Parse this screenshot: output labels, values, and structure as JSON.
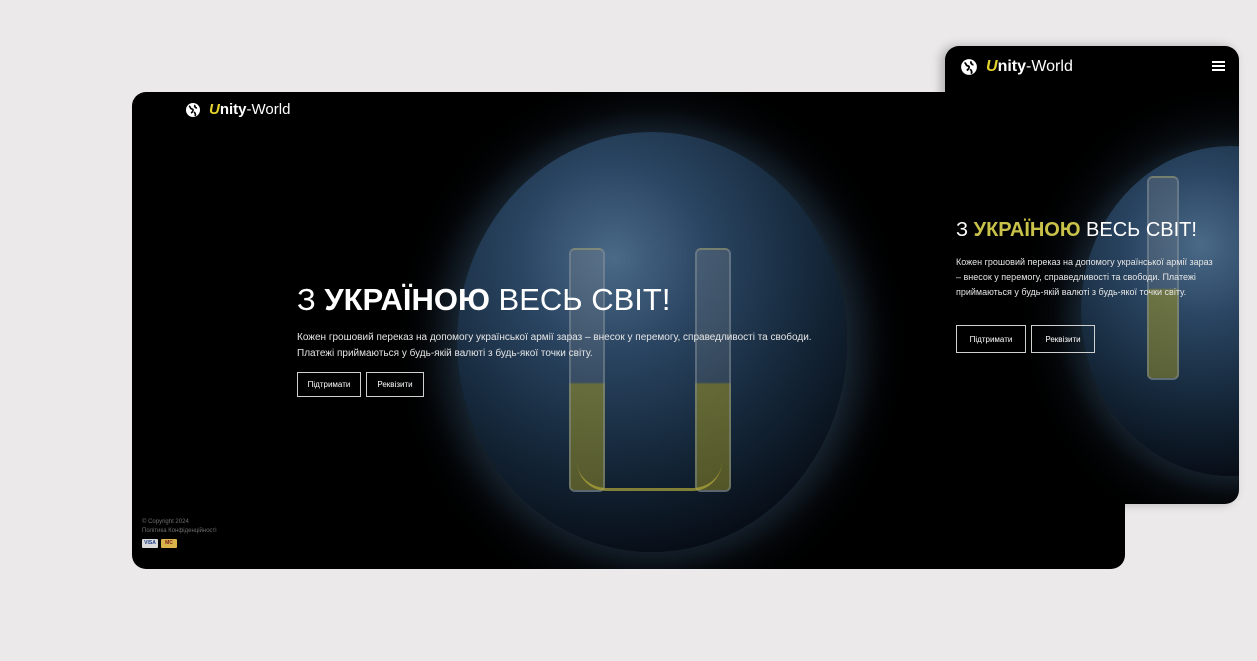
{
  "desktop": {
    "logo": {
      "u": "U",
      "rest": "nity",
      "suffix": "-World"
    },
    "hero": {
      "title_prefix": "З ",
      "title_bold": "УКРАЇНОЮ",
      "title_suffix": " ВЕСЬ СВІТ!",
      "text_line1": "Кожен грошовий переказ на допомогу української армії зараз – внесок у перемогу, справедливості та свободи.",
      "text_line2": "Платежі приймаються у будь-якій валюті з будь-якої точки світу."
    },
    "buttons": {
      "support": "Підтримати",
      "requisites": "Реквізити"
    },
    "footer": {
      "copyright": "© Copyright 2024",
      "privacy": "Політика Конфіденційності",
      "card1": "VISA",
      "card2": "MC"
    }
  },
  "mobile": {
    "logo": {
      "u": "U",
      "rest": "nity",
      "suffix": "-World"
    },
    "hero": {
      "title_prefix": "З ",
      "title_bold": "УКРАЇНОЮ",
      "title_suffix": " ВЕСЬ СВІТ!",
      "text": "Кожен грошовий переказ на допомогу української армії зараз – внесок у перемогу, справедливості та свободи. Платежі приймаються у будь-якій валюті з будь-якої точки світу."
    },
    "buttons": {
      "support": "Підтримати",
      "requisites": "Реквізити"
    }
  },
  "colors": {
    "page_bg": "#ebe9e9",
    "frame_bg": "#000000",
    "accent_yellow": "#e3d22b",
    "mobile_title_accent": "#c9c24a"
  },
  "icons": {
    "logo": "globe-icon",
    "menu": "hamburger-menu-icon"
  }
}
